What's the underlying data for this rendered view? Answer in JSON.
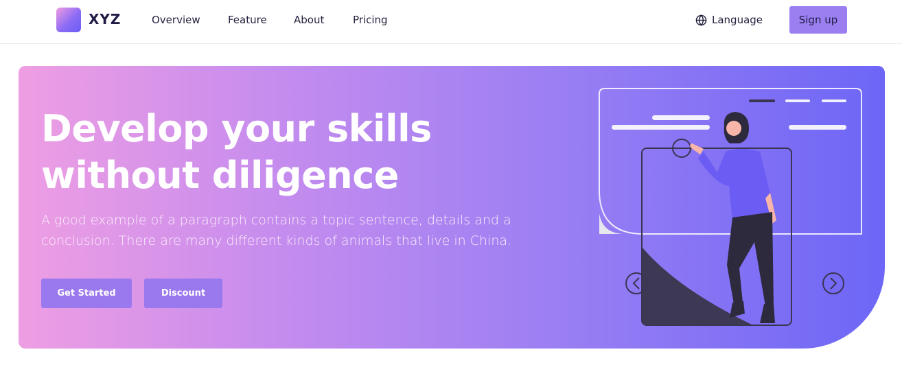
{
  "header": {
    "brand": "XYZ",
    "nav": [
      "Overview",
      "Feature",
      "About",
      "Pricing"
    ],
    "language_label": "Language",
    "signup_label": "Sign up"
  },
  "hero": {
    "title_line1": "Develop your skills",
    "title_line2": "without diligence",
    "paragraph_line1": "A good example of a paragraph contains a topic sentence, details and a",
    "paragraph_line2": "conclusion. There are many different kinds of animals that live in China.",
    "primary_button": "Get Started",
    "secondary_button": "Discount"
  },
  "colors": {
    "accent": "#9b7ff0",
    "gradient_start": "#ee9ee3",
    "gradient_end": "#6d66f6",
    "text_dark": "#201c46"
  },
  "icons": [
    "logo-mark",
    "globe-icon",
    "illustration-woman",
    "arrow-left-icon",
    "arrow-right-icon"
  ]
}
